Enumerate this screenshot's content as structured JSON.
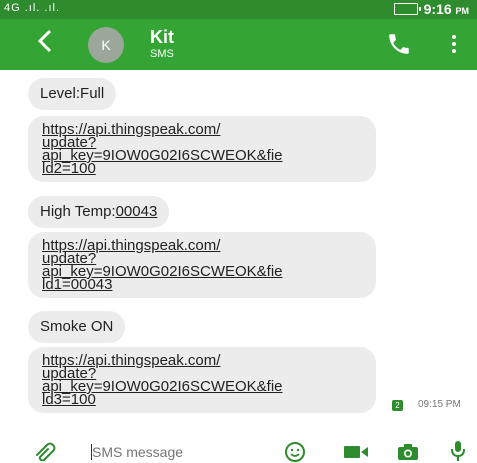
{
  "status_bar": {
    "signal_text": "4G .ıl. .ıl.",
    "time": "9:16",
    "ampm": "PM"
  },
  "header": {
    "back_icon": "chevron-left-icon",
    "avatar_letter": "K",
    "contact_name": "Kit",
    "contact_sub": "SMS",
    "colors": {
      "status": "#2e8b2e",
      "appbar": "#34a534"
    }
  },
  "messages": [
    {
      "type": "text",
      "text": "Level:Full"
    },
    {
      "type": "link",
      "lines": [
        "https://api.thingspeak.com/",
        "update?",
        "api_key=9IOW0G02I6SCWEOK&fie",
        "ld2=100"
      ]
    },
    {
      "type": "text",
      "prefix": "High Temp:",
      "linked": "00043"
    },
    {
      "type": "link",
      "lines": [
        "https://api.thingspeak.com/",
        "update?",
        "api_key=9IOW0G02I6SCWEOK&fie",
        "ld1=00043"
      ]
    },
    {
      "type": "text",
      "text": "Smoke ON"
    },
    {
      "type": "link",
      "lines": [
        "https://api.thingspeak.com/",
        "update?",
        "api_key=9IOW0G02I6SCWEOK&fie",
        "ld3=100"
      ]
    }
  ],
  "last_message_meta": {
    "sim": "2",
    "timestamp": "09:15 PM"
  },
  "compose": {
    "placeholder": "SMS message"
  }
}
